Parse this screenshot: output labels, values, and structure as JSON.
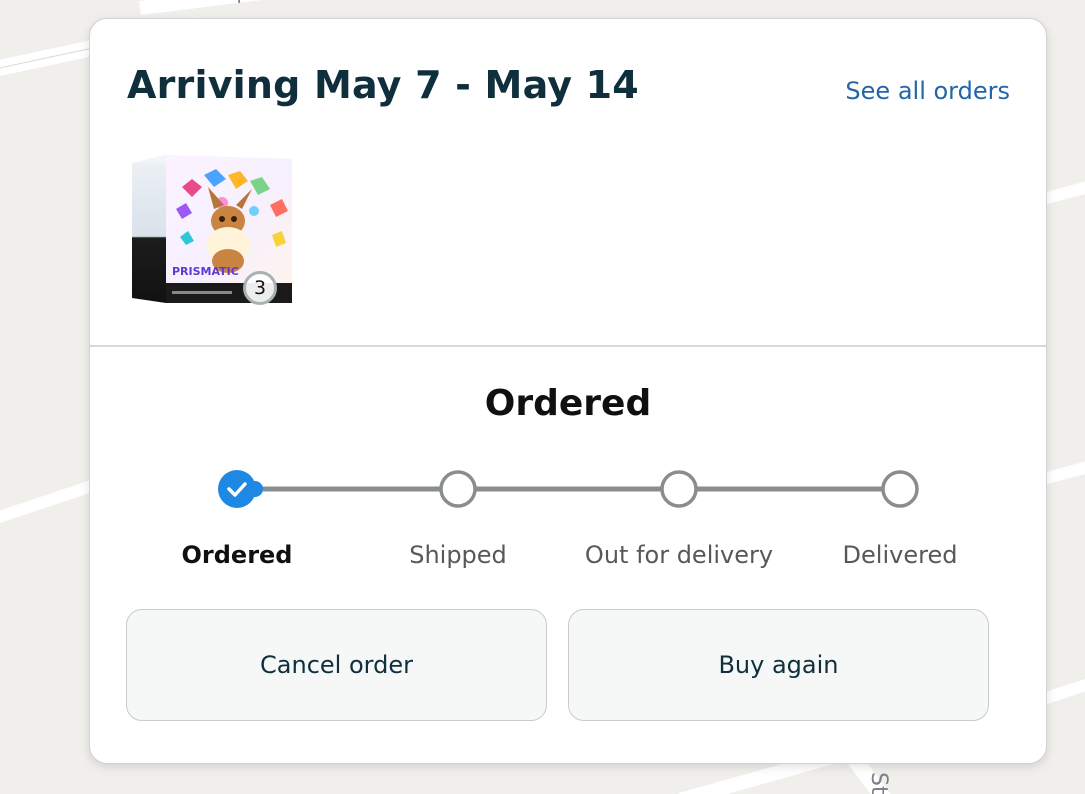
{
  "colors": {
    "accent": "#1e88e5",
    "title": "#0f2f3d",
    "link": "#2266a8",
    "track": "#8a8d8d",
    "map_bg": "#f1efeb"
  },
  "order_card": {
    "arrival_title": "Arriving May 7 - May 14",
    "see_all_link": "See all orders",
    "product": {
      "quantity": "3",
      "image_icon": "product-box-image",
      "box_text": "PRISMATIC"
    },
    "status_heading": "Ordered",
    "tracker": {
      "current_step_index": 0,
      "steps": [
        {
          "label": "Ordered",
          "state": "completed",
          "icon": "check-icon"
        },
        {
          "label": "Shipped",
          "state": "pending"
        },
        {
          "label": "Out for delivery",
          "state": "pending"
        },
        {
          "label": "Delivered",
          "state": "pending"
        }
      ]
    },
    "actions": {
      "cancel_label": "Cancel order",
      "buy_again_label": "Buy again"
    }
  },
  "map": {
    "street_label_partial": "St"
  }
}
